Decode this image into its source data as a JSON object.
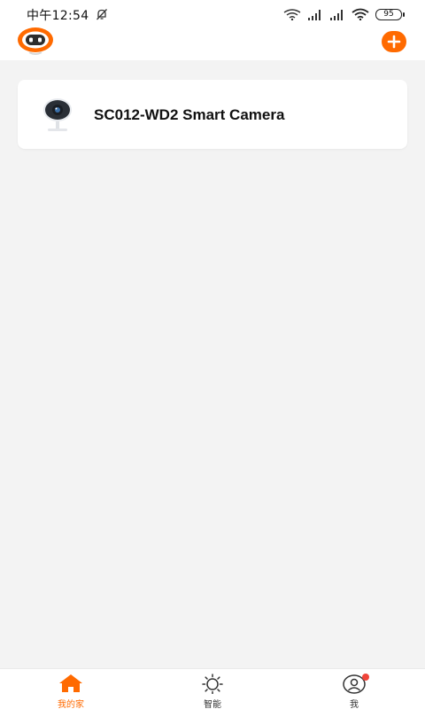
{
  "status_bar": {
    "time": "中午12:54",
    "battery": "95"
  },
  "app_bar": {
    "logo_icon": "robot-logo-icon",
    "add_icon": "plus-icon"
  },
  "devices": [
    {
      "name": "SC012-WD2 Smart Camera",
      "icon": "camera-icon"
    }
  ],
  "tab_bar": {
    "tabs": [
      {
        "label": "我的家",
        "icon": "home-icon",
        "active": true
      },
      {
        "label": "智能",
        "icon": "sun-icon",
        "active": false
      },
      {
        "label": "我",
        "icon": "profile-icon",
        "active": false,
        "badge": true
      }
    ]
  },
  "colors": {
    "accent": "#ff6a00",
    "badge": "#f0443a",
    "background": "#f3f3f3"
  }
}
